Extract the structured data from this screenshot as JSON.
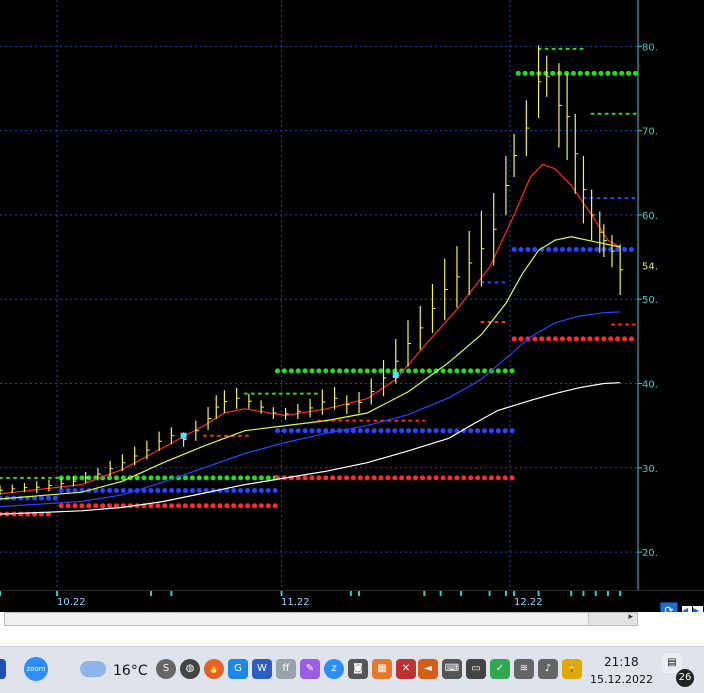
{
  "chart_data": {
    "type": "line",
    "y_axis": {
      "ticks": [
        "80.",
        "70.",
        "60.",
        "50.",
        "40.",
        "30.",
        "20."
      ],
      "tick_values": [
        80,
        70,
        60,
        50,
        40,
        30,
        20
      ],
      "range": [
        15.5,
        85.5
      ],
      "current_price_label": "54.",
      "current_price": 54
    },
    "x_axis": {
      "labels": [
        "10.22",
        "11.22",
        "12.22"
      ],
      "label_index": [
        14,
        69,
        125
      ],
      "index_range": [
        0,
        150
      ]
    },
    "grid": true,
    "bars": [
      [
        0,
        26.8,
        27.9
      ],
      [
        3,
        27.0,
        28.0
      ],
      [
        6,
        27.1,
        28.2
      ],
      [
        9,
        27.0,
        28.4
      ],
      [
        12,
        27.2,
        28.6
      ],
      [
        15,
        27.5,
        28.8
      ],
      [
        18,
        27.8,
        29.0
      ],
      [
        21,
        28.2,
        29.5
      ],
      [
        24,
        28.5,
        30.0
      ],
      [
        27,
        29.0,
        30.8
      ],
      [
        30,
        29.6,
        31.6
      ],
      [
        33,
        30.3,
        32.5
      ],
      [
        36,
        31.0,
        33.2
      ],
      [
        39,
        32.0,
        34.3
      ],
      [
        42,
        32.8,
        34.8
      ],
      [
        45,
        32.5,
        34.2
      ],
      [
        48,
        33.2,
        35.6
      ],
      [
        51,
        34.5,
        37.2
      ],
      [
        53,
        35.8,
        38.6
      ],
      [
        55,
        36.5,
        39.2
      ],
      [
        58,
        37.0,
        39.5
      ],
      [
        61,
        37.0,
        38.8
      ],
      [
        64,
        36.4,
        38.0
      ],
      [
        67,
        35.8,
        37.2
      ],
      [
        70,
        35.7,
        37.1
      ],
      [
        73,
        35.8,
        37.6
      ],
      [
        76,
        36.0,
        38.2
      ],
      [
        79,
        36.3,
        39.3
      ],
      [
        82,
        36.9,
        39.6
      ],
      [
        85,
        36.4,
        38.6
      ],
      [
        88,
        36.5,
        39.0
      ],
      [
        91,
        37.5,
        40.6
      ],
      [
        94,
        38.5,
        42.8
      ],
      [
        97,
        40.0,
        45.3
      ],
      [
        100,
        42.0,
        47.5
      ],
      [
        103,
        44.0,
        49.2
      ],
      [
        106,
        46.0,
        51.8
      ],
      [
        109,
        47.5,
        54.8
      ],
      [
        112,
        49.0,
        56.3
      ],
      [
        115,
        50.5,
        58.1
      ],
      [
        118,
        51.5,
        60.5
      ],
      [
        121,
        54.0,
        62.6
      ],
      [
        124,
        60.0,
        67.0
      ],
      [
        126,
        64.5,
        69.6
      ],
      [
        129,
        67.0,
        73.6
      ],
      [
        132,
        71.5,
        80.1
      ],
      [
        134,
        74.0,
        78.9
      ],
      [
        137,
        68.0,
        78.0
      ],
      [
        139,
        66.5,
        76.8
      ],
      [
        141,
        62.5,
        72.0
      ],
      [
        143,
        59.0,
        67.0
      ],
      [
        145,
        57.0,
        63.0
      ],
      [
        147,
        55.5,
        60.4
      ],
      [
        148,
        55.0,
        58.9
      ],
      [
        150,
        53.8,
        57.6
      ],
      [
        152,
        50.5,
        56.5
      ]
    ],
    "series": [
      {
        "color": "#ff2a2a",
        "points": [
          [
            0,
            26.9
          ],
          [
            20,
            28.0
          ],
          [
            30,
            29.8
          ],
          [
            40,
            32.4
          ],
          [
            50,
            35.0
          ],
          [
            55,
            36.5
          ],
          [
            60,
            37.0
          ],
          [
            70,
            36.2
          ],
          [
            80,
            37.0
          ],
          [
            90,
            38.2
          ],
          [
            97,
            40.5
          ],
          [
            105,
            45.0
          ],
          [
            112,
            48.8
          ],
          [
            120,
            53.8
          ],
          [
            126,
            60.0
          ],
          [
            130,
            64.5
          ],
          [
            133,
            66.0
          ],
          [
            136,
            65.5
          ],
          [
            140,
            63.5
          ],
          [
            145,
            60.0
          ],
          [
            149,
            57.0
          ],
          [
            152,
            56.2
          ]
        ]
      },
      {
        "color": "#d8ff36",
        "points": [
          [
            0,
            26.3
          ],
          [
            20,
            27.1
          ],
          [
            30,
            28.4
          ],
          [
            40,
            30.6
          ],
          [
            50,
            32.6
          ],
          [
            60,
            34.4
          ],
          [
            70,
            35.0
          ],
          [
            80,
            35.6
          ],
          [
            90,
            36.5
          ],
          [
            100,
            39.0
          ],
          [
            110,
            42.5
          ],
          [
            118,
            45.8
          ],
          [
            124,
            49.5
          ],
          [
            128,
            53.0
          ],
          [
            132,
            55.8
          ],
          [
            136,
            57.0
          ],
          [
            140,
            57.4
          ],
          [
            146,
            56.8
          ],
          [
            152,
            56.2
          ]
        ]
      },
      {
        "color": "#2a44ff",
        "points": [
          [
            0,
            25.4
          ],
          [
            20,
            26.0
          ],
          [
            30,
            26.8
          ],
          [
            40,
            28.3
          ],
          [
            50,
            30.0
          ],
          [
            60,
            31.7
          ],
          [
            70,
            33.0
          ],
          [
            80,
            34.1
          ],
          [
            90,
            35.0
          ],
          [
            100,
            36.3
          ],
          [
            110,
            38.3
          ],
          [
            118,
            40.5
          ],
          [
            124,
            43.0
          ],
          [
            130,
            45.5
          ],
          [
            136,
            47.2
          ],
          [
            142,
            48.0
          ],
          [
            148,
            48.4
          ],
          [
            152,
            48.5
          ]
        ]
      },
      {
        "color": "#ffffff",
        "points": [
          [
            0,
            24.5
          ],
          [
            20,
            24.9
          ],
          [
            30,
            25.3
          ],
          [
            40,
            26.0
          ],
          [
            50,
            27.0
          ],
          [
            60,
            28.0
          ],
          [
            70,
            28.8
          ],
          [
            80,
            29.6
          ],
          [
            90,
            30.6
          ],
          [
            100,
            32.0
          ],
          [
            110,
            33.5
          ],
          [
            116,
            35.2
          ],
          [
            122,
            36.8
          ],
          [
            130,
            38.0
          ],
          [
            136,
            38.8
          ],
          [
            142,
            39.5
          ],
          [
            148,
            40.0
          ],
          [
            152,
            40.1
          ]
        ]
      }
    ],
    "levels": [
      {
        "color": "#22dd22",
        "value": 28.8,
        "from": 0,
        "to": 15,
        "style": "dotted"
      },
      {
        "color": "#22dd22",
        "value": 28.8,
        "from": 15,
        "to": 68,
        "style": "thick"
      },
      {
        "color": "#22dd22",
        "value": 41.5,
        "from": 68,
        "to": 127,
        "style": "thick"
      },
      {
        "color": "#22dd22",
        "value": 76.8,
        "from": 127,
        "to": 157,
        "style": "thick"
      },
      {
        "color": "#2a44ff",
        "value": 27.3,
        "from": 15,
        "to": 68,
        "style": "thick"
      },
      {
        "color": "#2a44ff",
        "value": 26.4,
        "from": 0,
        "to": 15,
        "style": "thick"
      },
      {
        "color": "#2a44ff",
        "value": 34.4,
        "from": 68,
        "to": 126,
        "style": "thick"
      },
      {
        "color": "#2a44ff",
        "value": 55.9,
        "from": 126,
        "to": 157,
        "style": "thick"
      },
      {
        "color": "#ff2a2a",
        "value": 25.5,
        "from": 15,
        "to": 68,
        "style": "thick"
      },
      {
        "color": "#ff2a2a",
        "value": 24.5,
        "from": 0,
        "to": 12,
        "style": "thick"
      },
      {
        "color": "#ff2a2a",
        "value": 28.8,
        "from": 68,
        "to": 126,
        "style": "thick"
      },
      {
        "color": "#ff2a2a",
        "value": 45.3,
        "from": 126,
        "to": 157,
        "style": "thick"
      },
      {
        "color": "#22dd22",
        "value": 38.8,
        "from": 60,
        "to": 78,
        "style": "dotted"
      },
      {
        "color": "#22dd22",
        "value": 79.7,
        "from": 132,
        "to": 143,
        "style": "dotted"
      },
      {
        "color": "#22dd22",
        "value": 72.0,
        "from": 145,
        "to": 157,
        "style": "dotted"
      },
      {
        "color": "#2a44ff",
        "value": 62.0,
        "from": 143,
        "to": 157,
        "style": "dotted"
      },
      {
        "color": "#ff2a2a",
        "value": 47.0,
        "from": 150,
        "to": 157,
        "style": "dotted"
      },
      {
        "color": "#ff2a2a",
        "value": 35.6,
        "from": 78,
        "to": 104,
        "style": "dotted"
      },
      {
        "color": "#ff2a2a",
        "value": 33.8,
        "from": 50,
        "to": 62,
        "style": "dotted"
      },
      {
        "color": "#ff2a2a",
        "value": 47.3,
        "from": 118,
        "to": 124,
        "style": "dotted"
      },
      {
        "color": "#2a44ff",
        "value": 52.0,
        "from": 118,
        "to": 124,
        "style": "dotted"
      }
    ],
    "markers": [
      {
        "x": 45,
        "y": 33.8,
        "color": "#55e0ff"
      },
      {
        "x": 97,
        "y": 41.0,
        "color": "#55e0ff"
      }
    ]
  },
  "toolbar": {
    "refresh_icon": "refresh-icon",
    "nav_left_icon": "arrow-left-icon",
    "nav_right_icon": "arrow-right-icon",
    "scroll_arrow": "▸"
  },
  "taskbar": {
    "weather_temp": "16°C",
    "clock_time": "21:18",
    "clock_date": "15.12.2022",
    "notification_count": "26",
    "zoom_label": "zoom"
  },
  "colors": {
    "grid": "#1f3fbf",
    "axis_text": "#2fd0d0",
    "price_label": "#e8e85a",
    "bar": "#f2f25a"
  }
}
